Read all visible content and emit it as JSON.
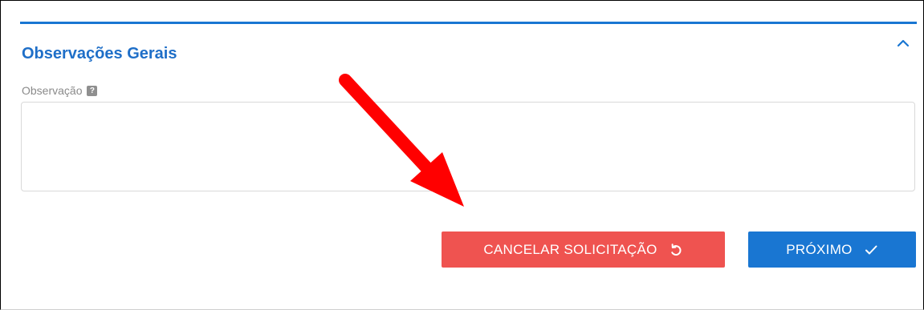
{
  "section": {
    "title": "Observações Gerais"
  },
  "field": {
    "label": "Observação",
    "help_icon_text": "?",
    "value": ""
  },
  "actions": {
    "cancel_label": "CANCELAR SOLICITAÇÃO",
    "next_label": "PRÓXIMO"
  },
  "icons": {
    "collapse": "chevron-up-icon",
    "help": "help-icon",
    "cancel": "undo-icon",
    "next": "check-icon",
    "annotation": "red-arrow-icon"
  },
  "colors": {
    "accent": "#1976d2",
    "title": "#1f6fc8",
    "danger": "#ef5350",
    "annotation": "#ff0000"
  }
}
